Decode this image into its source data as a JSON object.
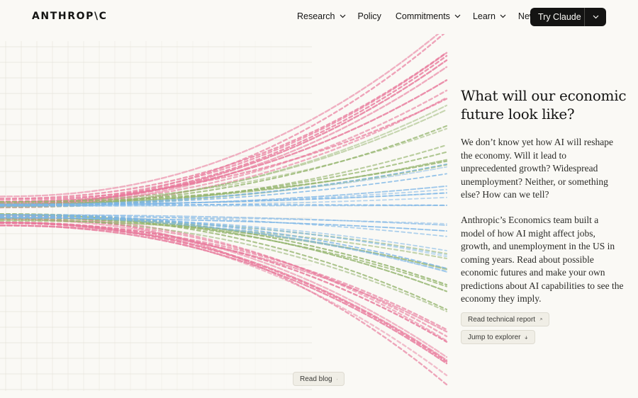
{
  "brand": {
    "logo_text": "ANTHROP\\C"
  },
  "nav": {
    "items": [
      {
        "label": "Research",
        "dropdown": true
      },
      {
        "label": "Policy",
        "dropdown": false
      },
      {
        "label": "Commitments",
        "dropdown": true
      },
      {
        "label": "Learn",
        "dropdown": true
      },
      {
        "label": "News",
        "dropdown": false
      }
    ],
    "cta_label": "Try Claude"
  },
  "hero": {
    "title": "What will our economic future look like?",
    "paragraph_1": "We don’t know yet how AI will reshape the economy. Will it lead to unprecedented growth? Widespread unemployment? Neither, or something else? How can we tell?",
    "paragraph_2": "Anthropic’s Economics team built a model of how AI might affect jobs, growth, and unemployment in the US in coming years. Read about possible economic futures and make your own predictions about AI capabilities to see the economy they imply.",
    "report_button": "Read technical report",
    "explorer_button": "Jump to explorer",
    "blog_button": "Read blog"
  },
  "colors": {
    "background": "#faf9f5",
    "text": "#141413",
    "pink": "#e8799b",
    "green": "#93b36c",
    "blue": "#7db6e6",
    "grid": "#e6e3da"
  },
  "icons": {
    "menu_chevron": "chevron-down-icon",
    "report_icon": "arrow-up-right-icon",
    "explorer_icon": "arrow-down-icon",
    "blog_icon": "arrow-down-icon"
  }
}
